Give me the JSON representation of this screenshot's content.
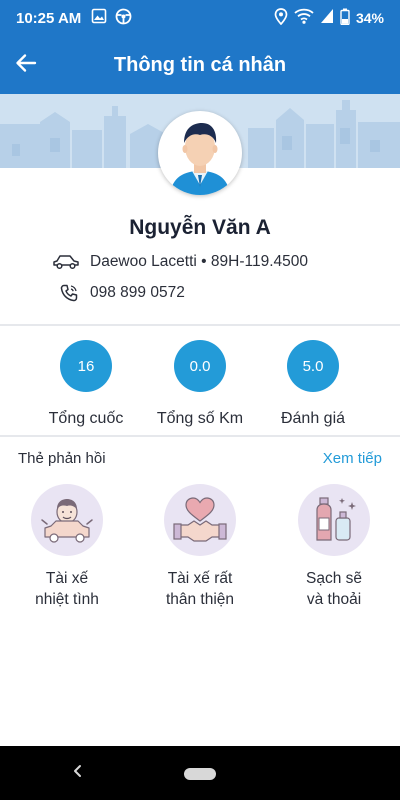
{
  "status_bar": {
    "time": "10:25 AM",
    "battery": "34%"
  },
  "app_bar": {
    "title": "Thông tin cá nhân"
  },
  "profile": {
    "name": "Nguyễn Văn A",
    "car": "Daewoo Lacetti • 89H-119.4500",
    "phone": "098 899 0572"
  },
  "stats": [
    {
      "value": "16",
      "label": "Tổng cuốc"
    },
    {
      "value": "0.0",
      "label": "Tổng số Km"
    },
    {
      "value": "5.0",
      "label": "Đánh giá"
    }
  ],
  "feedback": {
    "title": "Thẻ phản hồi",
    "more": "Xem tiếp",
    "items": [
      {
        "line1": "Tài xế",
        "line2": "nhiệt tình"
      },
      {
        "line1": "Tài xế rất",
        "line2": "thân thiện"
      },
      {
        "line1": "Sạch sẽ",
        "line2": "và thoải"
      }
    ]
  },
  "colors": {
    "primary": "#1f77c8",
    "accent": "#239bd8",
    "icon_bg": "#e9e4f3"
  }
}
